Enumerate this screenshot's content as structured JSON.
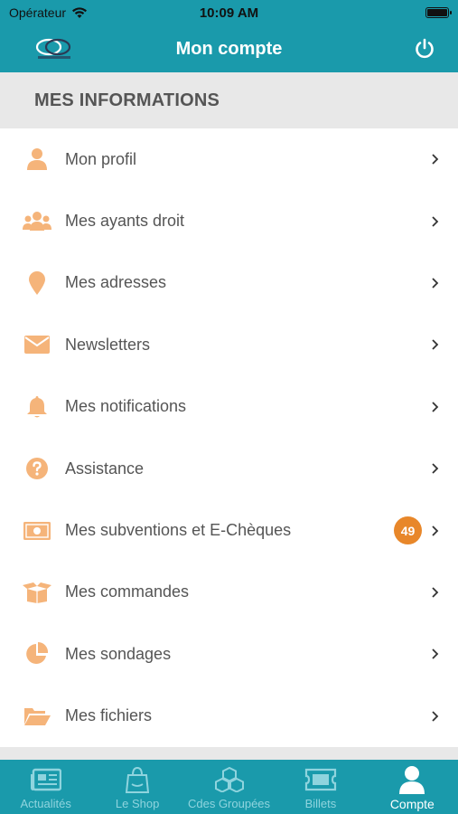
{
  "status_bar": {
    "carrier": "Opérateur",
    "time": "10:09 AM"
  },
  "header": {
    "title": "Mon compte"
  },
  "section": {
    "title": "MES INFORMATIONS"
  },
  "menu": [
    {
      "label": "Mon profil",
      "icon": "person-icon"
    },
    {
      "label": "Mes ayants droit",
      "icon": "users-icon"
    },
    {
      "label": "Mes adresses",
      "icon": "map-pin-icon"
    },
    {
      "label": "Newsletters",
      "icon": "envelope-icon"
    },
    {
      "label": "Mes notifications",
      "icon": "bell-icon"
    },
    {
      "label": "Assistance",
      "icon": "question-circle-icon"
    },
    {
      "label": "Mes subventions et E-Chèques",
      "icon": "money-bill-icon",
      "badge": "49"
    },
    {
      "label": "Mes commandes",
      "icon": "box-open-icon"
    },
    {
      "label": "Mes sondages",
      "icon": "pie-chart-icon"
    },
    {
      "label": "Mes fichiers",
      "icon": "folder-open-icon"
    }
  ],
  "tabs": [
    {
      "label": "Actualités",
      "icon": "newspaper-icon",
      "active": false
    },
    {
      "label": "Le Shop",
      "icon": "shop-bag-icon",
      "active": false
    },
    {
      "label": "Cdes Groupées",
      "icon": "cubes-icon",
      "active": false
    },
    {
      "label": "Billets",
      "icon": "ticket-icon",
      "active": false
    },
    {
      "label": "Compte",
      "icon": "user-icon",
      "active": true
    }
  ],
  "colors": {
    "primary": "#1a9aab",
    "icon_accent": "#f5b47a",
    "badge": "#e8872a",
    "text": "#555555",
    "section_bg": "#e8e8e8",
    "tab_inactive": "#8fd4de"
  }
}
